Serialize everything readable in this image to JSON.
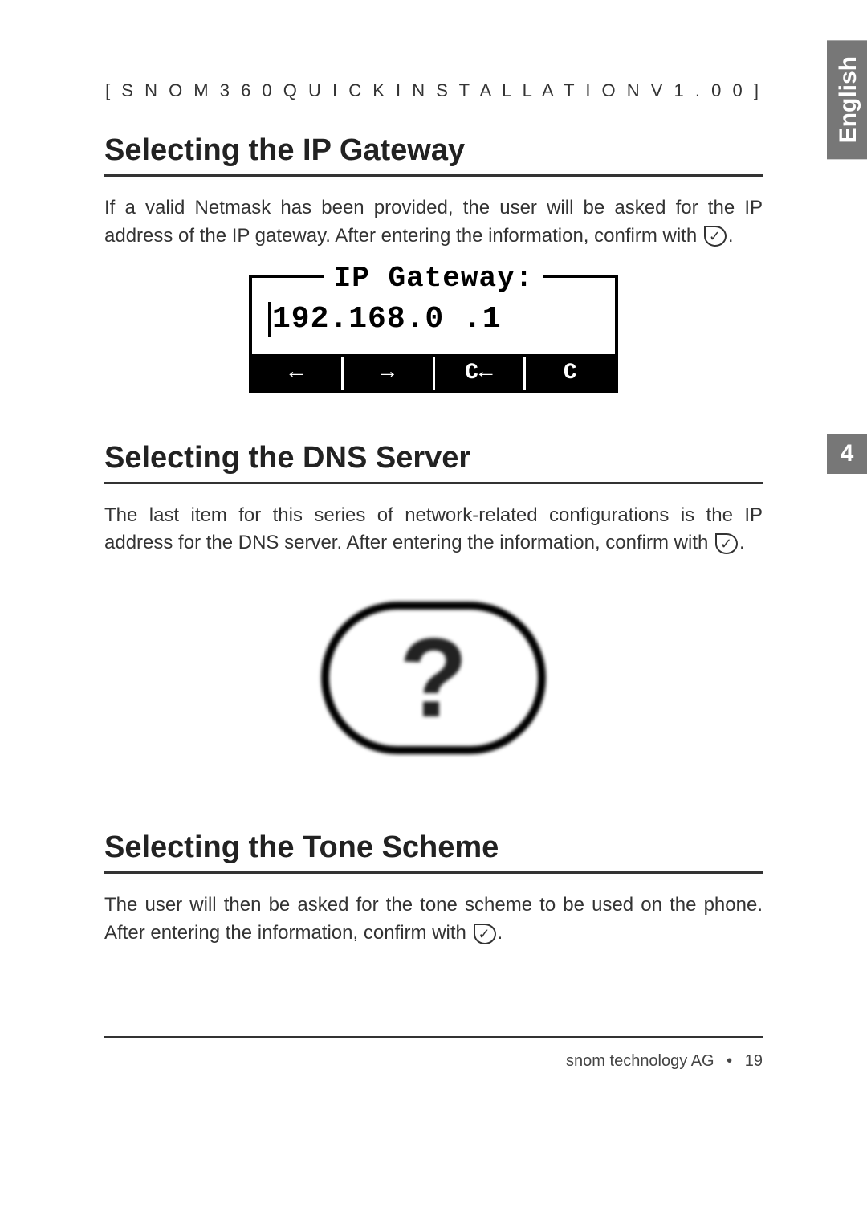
{
  "side": {
    "lang": "English",
    "chapter": "4"
  },
  "header": "[  S N O M   3 6 0   Q U I C K   I N S T A L L A T I O N   V 1 . 0 0  ]",
  "sections": {
    "gw": {
      "title": "Selecting the IP Gateway",
      "text_pre": "If a valid Netmask has been provided, the user will be asked for the IP address of the IP gateway.  After entering the information, confirm with ",
      "text_post": "."
    },
    "dns": {
      "title": "Selecting the DNS Server",
      "text_pre": "The last item for this series of network-related configurations is the IP address for the DNS server.  After entering the information, confirm with ",
      "text_post": "."
    },
    "tone": {
      "title": "Selecting the Tone Scheme",
      "text_pre": "The user will then be asked for the tone scheme to be used on the phone.  After entering the information, confirm with ",
      "text_post": "."
    }
  },
  "lcd": {
    "legend": "IP Gateway:",
    "value": "192.168.0  .1",
    "btns": {
      "b1": "←",
      "b2": "→",
      "b3": "C←",
      "b4": "C"
    }
  },
  "qmark": "?",
  "footer": {
    "company": "snom technology AG",
    "bullet": "•",
    "page": "19"
  }
}
